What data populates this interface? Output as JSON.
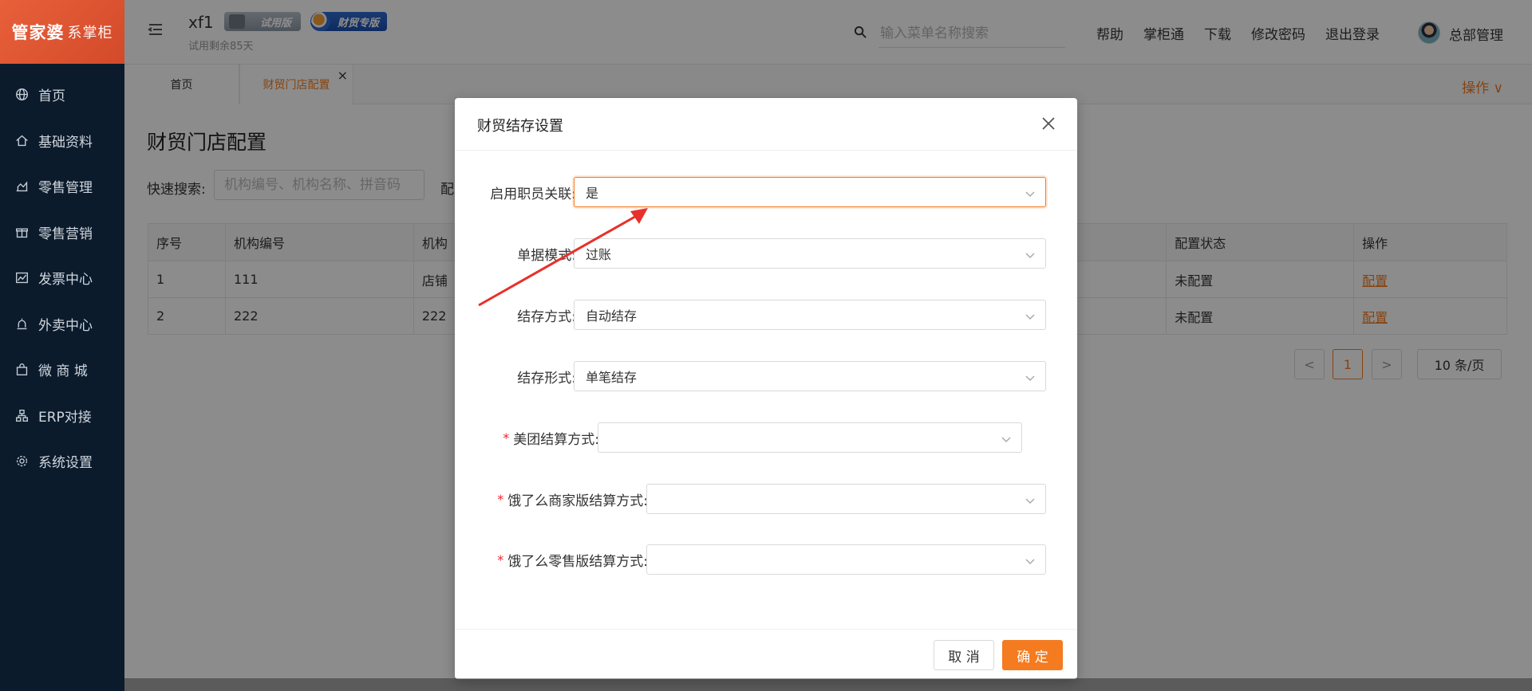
{
  "sidebar": {
    "logo_main": "管家婆",
    "logo_sub": "系掌柜",
    "items": [
      {
        "label": "首页",
        "icon": "globe-icon"
      },
      {
        "label": "基础资料",
        "icon": "home-icon"
      },
      {
        "label": "零售管理",
        "icon": "bar-chart-icon"
      },
      {
        "label": "零售营销",
        "icon": "gift-icon"
      },
      {
        "label": "发票中心",
        "icon": "line-chart-icon"
      },
      {
        "label": "外卖中心",
        "icon": "alarm-icon"
      },
      {
        "label": "微 商 城",
        "icon": "bag-icon"
      },
      {
        "label": "ERP对接",
        "icon": "sitemap-icon"
      },
      {
        "label": "系统设置",
        "icon": "gear-icon"
      }
    ]
  },
  "header": {
    "org_name": "xf1",
    "trial_badge": "试用版",
    "caimao_badge": "财贸专版",
    "trial_days": "试用剩余85天",
    "search_placeholder": "输入菜单名称搜索",
    "links": [
      "帮助",
      "掌柜通",
      "下载",
      "修改密码",
      "退出登录"
    ],
    "user_name": "总部管理"
  },
  "tabs": {
    "home": "首页",
    "active": "财贸门店配置",
    "close": "×",
    "operations": "操作 ∨"
  },
  "page": {
    "title": "财贸门店配置",
    "quick_search_label": "快速搜索:",
    "quick_search_placeholder": "机构编号、机构名称、拼音码",
    "config_label": "配",
    "table": {
      "headers": [
        "序号",
        "机构编号",
        "机构",
        "配置状态",
        "操作"
      ],
      "rows": [
        [
          "1",
          "111",
          "店铺",
          "未配置",
          "配置"
        ],
        [
          "2",
          "222",
          "222",
          "未配置",
          "配置"
        ]
      ]
    },
    "pagination": {
      "prev": "<",
      "current": "1",
      "next": ">",
      "page_size": "10 条/页"
    }
  },
  "modal": {
    "title": "财贸结存设置",
    "fields": [
      {
        "label": "启用职员关联:",
        "value": "是",
        "required": false
      },
      {
        "label": "单据模式:",
        "value": "过账",
        "required": false
      },
      {
        "label": "结存方式:",
        "value": "自动结存",
        "required": false
      },
      {
        "label": "结存形式:",
        "value": "单笔结存",
        "required": false
      },
      {
        "label": "美团结算方式:",
        "value": "",
        "required": true
      },
      {
        "label": "饿了么商家版结算方式:",
        "value": "",
        "required": true
      },
      {
        "label": "饿了么零售版结算方式:",
        "value": "",
        "required": true
      }
    ],
    "required_mark": "*",
    "cancel": "取 消",
    "ok": "确 定"
  },
  "colors": {
    "accent": "#f47b20",
    "sidebar_bg": "#0b1b2c",
    "annotation_arrow": "#e8312a"
  }
}
